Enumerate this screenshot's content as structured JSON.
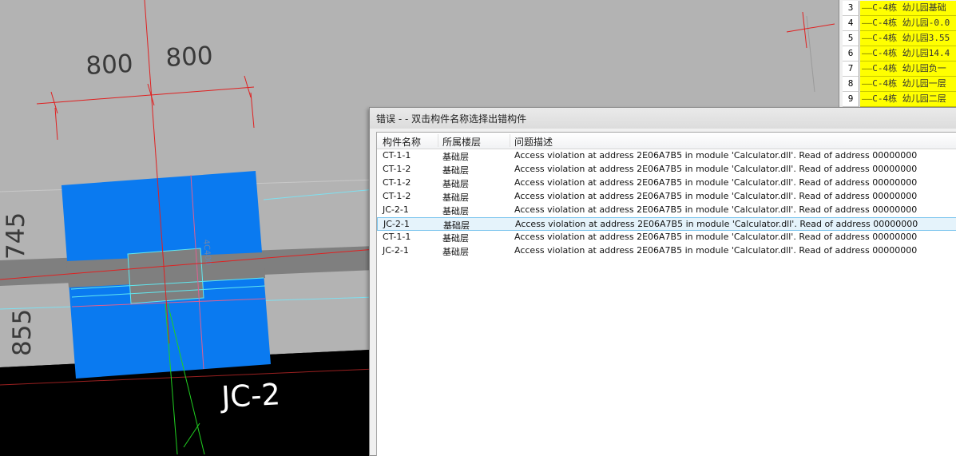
{
  "drawing": {
    "dim_top_left": "800",
    "dim_top_right": "800",
    "dim_left_upper": "745",
    "dim_left_lower": "855",
    "footing_label": "JC-2"
  },
  "floor_list": [
    {
      "num": "3",
      "name": "C-4栋 幼儿园基础"
    },
    {
      "num": "4",
      "name": "C-4栋 幼儿园-0.0"
    },
    {
      "num": "5",
      "name": "C-4栋 幼儿园3.55"
    },
    {
      "num": "6",
      "name": "C-4栋 幼儿园14.4"
    },
    {
      "num": "7",
      "name": "C-4栋 幼儿园负一"
    },
    {
      "num": "8",
      "name": "C-4栋 幼儿园一层"
    },
    {
      "num": "9",
      "name": "C-4栋 幼儿园二层"
    }
  ],
  "dialog": {
    "title": "错误 -  - 双击构件名称选择出错构件",
    "columns": [
      "构件名称",
      "所属楼层",
      "问题描述"
    ],
    "rows": [
      {
        "name": "CT-1-1",
        "floor": "基础层",
        "desc": "Access violation at address 2E06A7B5 in module 'Calculator.dll'. Read of address 00000000"
      },
      {
        "name": "CT-1-2",
        "floor": "基础层",
        "desc": "Access violation at address 2E06A7B5 in module 'Calculator.dll'. Read of address 00000000"
      },
      {
        "name": "CT-1-2",
        "floor": "基础层",
        "desc": "Access violation at address 2E06A7B5 in module 'Calculator.dll'. Read of address 00000000"
      },
      {
        "name": "CT-1-2",
        "floor": "基础层",
        "desc": "Access violation at address 2E06A7B5 in module 'Calculator.dll'. Read of address 00000000"
      },
      {
        "name": "JC-2-1",
        "floor": "基础层",
        "desc": "Access violation at address 2E06A7B5 in module 'Calculator.dll'. Read of address 00000000"
      },
      {
        "name": "JC-2-1",
        "floor": "基础层",
        "desc": "Access violation at address 2E06A7B5 in module 'Calculator.dll'. Read of address 00000000",
        "selected": true
      },
      {
        "name": "CT-1-1",
        "floor": "基础层",
        "desc": "Access violation at address 2E06A7B5 in module 'Calculator.dll'. Read of address 00000000"
      },
      {
        "name": "JC-2-1",
        "floor": "基础层",
        "desc": "Access violation at address 2E06A7B5 in module 'Calculator.dll'. Read of address 00000000"
      }
    ]
  },
  "colors": {
    "footing_blue": "#0a7af0",
    "beam_gray": "#7f7f7f",
    "axis_red": "#e02020",
    "floor_yellow": "#ffff00",
    "selection": "#e5f3fb"
  }
}
